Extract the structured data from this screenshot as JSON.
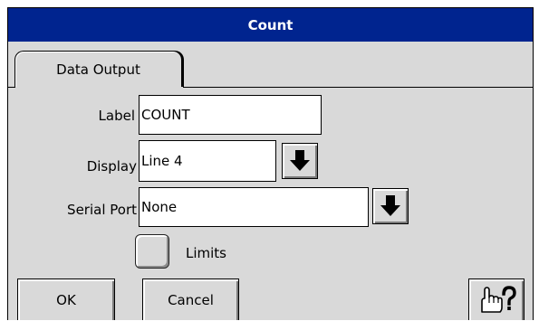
{
  "window": {
    "title": "Count"
  },
  "tabs": [
    {
      "label": "Data Output",
      "active": true
    }
  ],
  "form": {
    "label": {
      "caption": "Label",
      "value": "COUNT"
    },
    "display": {
      "caption": "Display",
      "value": "Line 4"
    },
    "serial_port": {
      "caption": "Serial Port",
      "value": "None"
    },
    "limits": {
      "caption": "Limits",
      "checked": false
    }
  },
  "buttons": {
    "ok": "OK",
    "cancel": "Cancel"
  },
  "icons": {
    "dropdown": "down-arrow-icon",
    "help": "hand-pointer-help-icon"
  },
  "colors": {
    "titlebar": "#00248f",
    "background": "#d9d9d9",
    "field": "#ffffff"
  }
}
